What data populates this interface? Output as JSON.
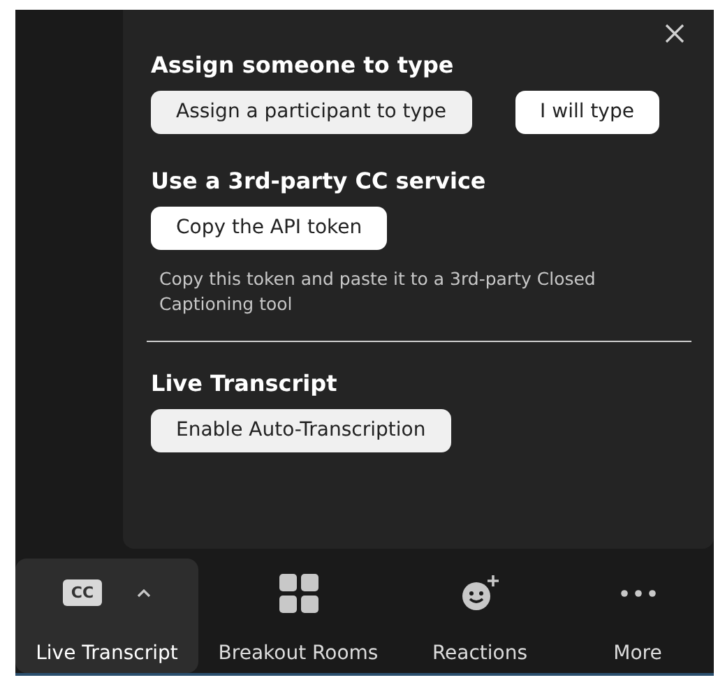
{
  "panel": {
    "sections": [
      {
        "heading": "Assign someone to type",
        "buttons": [
          {
            "label": "Assign a participant to type",
            "selected": true
          },
          {
            "label": "I will type",
            "selected": false
          }
        ]
      },
      {
        "heading": "Use a 3rd-party CC service",
        "buttons": [
          {
            "label": "Copy the API token",
            "selected": false
          }
        ],
        "description": "Copy this token and paste it to a 3rd-party Closed Captioning tool"
      },
      {
        "heading": "Live Transcript",
        "buttons": [
          {
            "label": "Enable Auto-Transcription",
            "selected": true
          }
        ],
        "divider_before": true
      }
    ]
  },
  "toolbar": [
    {
      "kind": "cc",
      "label": "Live Transcript",
      "icon_text": "CC",
      "selected": true
    },
    {
      "kind": "grid",
      "label": "Breakout Rooms",
      "selected": false
    },
    {
      "kind": "emoji",
      "label": "Reactions",
      "selected": false
    },
    {
      "kind": "more",
      "label": "More",
      "selected": false
    }
  ]
}
